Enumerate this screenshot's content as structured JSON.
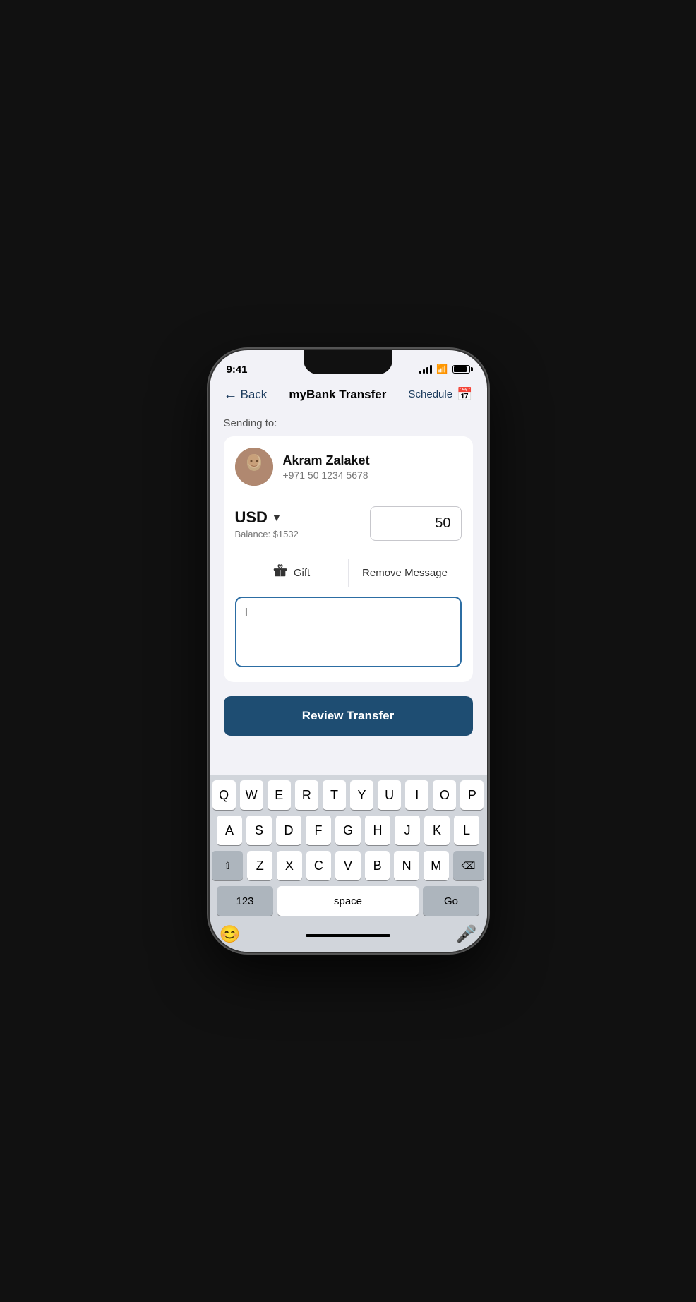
{
  "statusBar": {
    "time": "9:41",
    "batteryLevel": 90
  },
  "navBar": {
    "backLabel": "Back",
    "title": "myBank Transfer",
    "scheduleLabel": "Schedule"
  },
  "sendingLabel": "Sending to:",
  "recipient": {
    "name": "Akram Zalaket",
    "phone": "+971 50 1234 5678"
  },
  "currency": {
    "code": "USD",
    "balance": "Balance: $1532"
  },
  "amount": {
    "value": "50"
  },
  "giftButton": "Gift",
  "removeMessageButton": "Remove Message",
  "messageInput": {
    "value": "I",
    "placeholder": ""
  },
  "reviewButton": "Review Transfer",
  "keyboard": {
    "row1": [
      "Q",
      "W",
      "E",
      "R",
      "T",
      "Y",
      "U",
      "I",
      "O",
      "P"
    ],
    "row2": [
      "A",
      "S",
      "D",
      "F",
      "G",
      "H",
      "J",
      "K",
      "L"
    ],
    "row3": [
      "Z",
      "X",
      "C",
      "V",
      "B",
      "N",
      "M"
    ],
    "row4": {
      "numLabel": "123",
      "spaceLabel": "space",
      "goLabel": "Go"
    }
  }
}
